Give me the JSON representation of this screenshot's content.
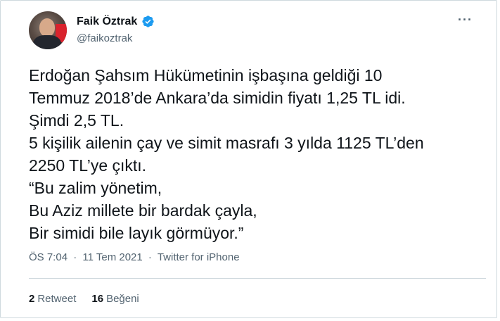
{
  "author": {
    "display_name": "Faik Öztrak",
    "handle": "@faikoztrak",
    "verified": true
  },
  "tweet": {
    "lines": [
      "Erdoğan Şahsım Hükümetinin işbaşına geldiği 10",
      "Temmuz 2018’de Ankara’da simidin fiyatı 1,25 TL idi.",
      "Şimdi 2,5 TL.",
      "5 kişilik ailenin çay ve simit masrafı 3 yılda 1125 TL’den",
      "2250 TL’ye çıktı.",
      "“Bu zalim yönetim,",
      "Bu Aziz millete bir bardak çayla,",
      "Bir simidi bile layık görmüyor.”"
    ],
    "time": "ÖS 7:04",
    "date": "11 Tem 2021",
    "source": "Twitter for iPhone"
  },
  "stats": {
    "retweet_count": "2",
    "retweet_label": "Retweet",
    "like_count": "16",
    "like_label": "Beğeni"
  },
  "icons": {
    "verified": "verified-badge-icon",
    "more": "more-options-icon"
  },
  "colors": {
    "verified": "#1d9bf0",
    "secondary_text": "#536471",
    "primary_text": "#0f1419",
    "border": "#cfd9de"
  }
}
